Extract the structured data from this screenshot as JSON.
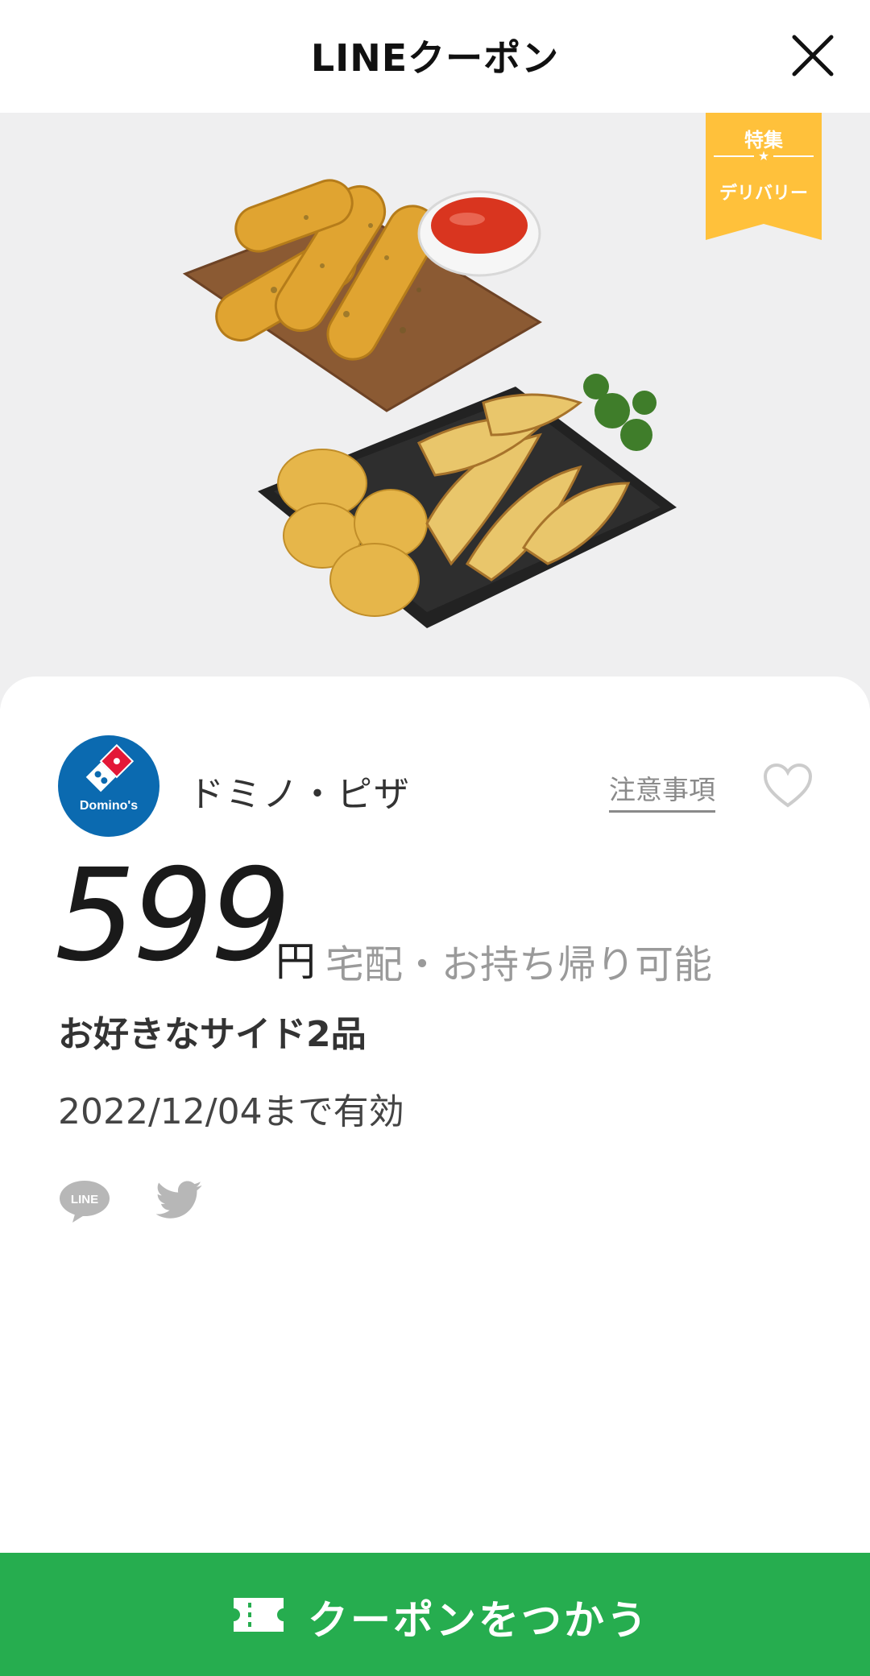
{
  "header": {
    "title": "LINEクーポン",
    "close_icon": "close-icon"
  },
  "hero": {
    "image_alt": "food-photo",
    "ribbon": {
      "top": "特集",
      "star": "★",
      "bottom": "デリバリー",
      "color": "#ffc13b"
    }
  },
  "store": {
    "logo_text": "Domino's",
    "name": "ドミノ・ピザ",
    "notice_label": "注意事項",
    "favorite_icon": "heart-icon"
  },
  "offer": {
    "price": "599",
    "unit": "円",
    "note": "宅配・お持ち帰り可能",
    "description": "お好きなサイド2品",
    "valid": "2022/12/04まで有効"
  },
  "share": {
    "line_icon": "line-icon",
    "line_text": "LINE",
    "twitter_icon": "twitter-icon"
  },
  "action": {
    "label": "クーポンをつかう",
    "icon": "ticket-icon",
    "color": "#26ad4f"
  }
}
